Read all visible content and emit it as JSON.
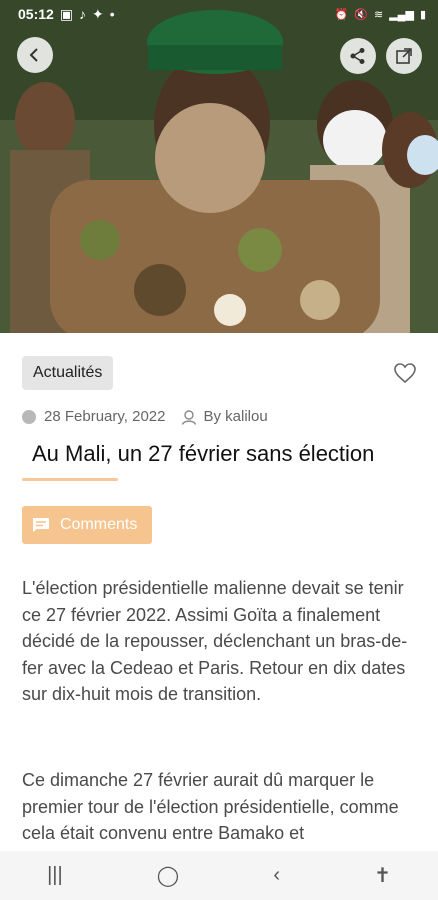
{
  "status_bar": {
    "time": "05:12",
    "left_icons": [
      "image-icon",
      "tiktok-icon",
      "twitter-icon",
      "dot-icon"
    ],
    "right_icons": [
      "alarm-icon",
      "mute-icon",
      "wifi-icon",
      "signal-icon",
      "battery-icon"
    ]
  },
  "article": {
    "category": "Actualités",
    "date": "28 February, 2022",
    "author": "By kalilou",
    "title": "Au Mali, un 27 février sans élection",
    "comments_label": "Comments",
    "paragraphs": [
      "L'élection présidentielle malienne devait se tenir ce 27 février 2022. Assimi Goïta a finalement décidé de la repousser, déclenchant un bras-de-fer avec la Cedeao et Paris. Retour en dix dates sur dix-huit mois de transition.",
      "Ce dimanche 27 février aurait dû marquer le premier tour de l'élection présidentielle, comme cela était convenu entre Bamako et"
    ]
  },
  "colors": {
    "accent": "#f6c48e",
    "underline": "#f5c79b",
    "category_bg": "#e5e5e5"
  },
  "nav": {
    "icons": [
      "recents-icon",
      "home-icon",
      "back-nav-icon",
      "accessibility-icon"
    ]
  }
}
